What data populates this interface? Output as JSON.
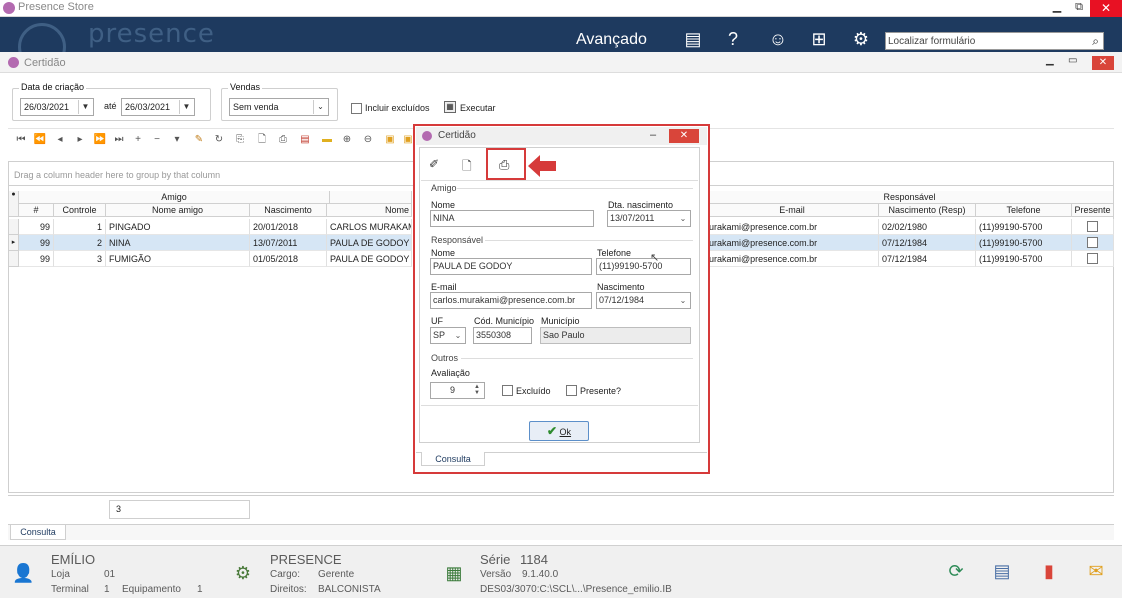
{
  "app": {
    "title": "Presence Store",
    "brand": "presence",
    "section": "Avançado",
    "search_placeholder": "Localizar formulário",
    "window_buttons": {
      "minimize": "▁",
      "restore": "⧉",
      "close": "✕"
    }
  },
  "child_window": {
    "title": "Certidão",
    "buttons": {
      "minimize": "▁",
      "restore": "▭",
      "close": "✕"
    }
  },
  "filters": {
    "date_group_label": "Data de criação",
    "date_from": "26/03/2021",
    "date_to_label": "até",
    "date_to": "26/03/2021",
    "sales_group_label": "Vendas",
    "sales_value": "Sem venda",
    "include_deleted_label": "Incluir excluídos",
    "execute_label": "Executar"
  },
  "grid": {
    "group_hint": "Drag a column header here to group by that column",
    "band_amigo": "Amigo",
    "band_responsavel": "Responsável",
    "columns": {
      "num": "#",
      "controle": "Controle",
      "nome_amigo": "Nome amigo",
      "nascimento": "Nascimento",
      "nome": "Nome",
      "email": "E-mail",
      "nasc_resp": "Nascimento (Resp)",
      "telefone": "Telefone",
      "presente": "Presente"
    },
    "rows": [
      {
        "num": "99",
        "controle": "1",
        "nome_amigo": "PINGADO",
        "nascimento": "20/01/2018",
        "nome": "CARLOS MURAKAMI",
        "email": "urakami@presence.com.br",
        "nasc_resp": "02/02/1980",
        "telefone": "(11)99190-5700"
      },
      {
        "num": "99",
        "controle": "2",
        "nome_amigo": "NINA",
        "nascimento": "13/07/2011",
        "nome": "PAULA DE GODOY",
        "email": "urakami@presence.com.br",
        "nasc_resp": "07/12/1984",
        "telefone": "(11)99190-5700"
      },
      {
        "num": "99",
        "controle": "3",
        "nome_amigo": "FUMIGÃO",
        "nascimento": "01/05/2018",
        "nome": "PAULA DE GODOY",
        "email": "urakami@presence.com.br",
        "nasc_resp": "07/12/1984",
        "telefone": "(11)99190-5700"
      }
    ],
    "count": "3"
  },
  "tab_consulta": "Consulta",
  "status": {
    "user_name": "EMÍLIO",
    "loja_label": "Loja",
    "loja": "01",
    "terminal_label": "Terminal",
    "terminal": "1",
    "equipamento_label": "Equipamento",
    "equipamento": "1",
    "company": "PRESENCE",
    "cargo_label": "Cargo:",
    "cargo": "Gerente",
    "direitos_label": "Direitos:",
    "direitos": "BALCONISTA",
    "serie_label": "Série",
    "serie": "1184",
    "versao_label": "Versão",
    "versao": "9.1.40.0",
    "db_path": "DES03/3070:C:\\SCL\\...\\Presence_emilio.IB"
  },
  "dialog": {
    "title": "Certidão",
    "buttons": {
      "minimize": "‒",
      "close": "✕"
    },
    "sec_amigo": "Amigo",
    "nome_label": "Nome",
    "nome": "NINA",
    "dtnasc_label": "Dta. nascimento",
    "dtnasc": "13/07/2011",
    "sec_resp": "Responsável",
    "rnome_label": "Nome",
    "rnome": "PAULA DE GODOY",
    "tel_label": "Telefone",
    "tel": "(11)99190-5700",
    "email_label": "E-mail",
    "email": "carlos.murakami@presence.com.br",
    "rnasc_label": "Nascimento",
    "rnasc": "07/12/1984",
    "uf_label": "UF",
    "uf": "SP",
    "codmun_label": "Cód. Município",
    "codmun": "3550308",
    "mun_label": "Município",
    "mun": "Sao Paulo",
    "sec_outros": "Outros",
    "aval_label": "Avaliação",
    "aval": "9",
    "excluido_label": "Excluído",
    "presente_label": "Presente?",
    "ok_label": "Ok",
    "tab": "Consulta"
  }
}
